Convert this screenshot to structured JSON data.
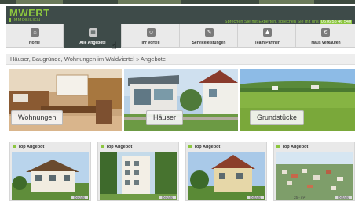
{
  "brand": {
    "name": "MWERT",
    "sub": "IMMOBILIEN",
    "contact_text": "Sprechen Sie mit Experten, sprechen Sie mit uns",
    "phone": "0676 55 46 540"
  },
  "nav": {
    "items": [
      {
        "label": "Home",
        "icon": "home-icon",
        "glyph": "⌂"
      },
      {
        "label": "Alle Angebote",
        "icon": "buildings-icon",
        "glyph": "▦",
        "active": true
      },
      {
        "label": "Ihr Vorteil",
        "icon": "smiley-icon",
        "glyph": "☺"
      },
      {
        "label": "Serviceleistungen",
        "icon": "wrench-icon",
        "glyph": "✎"
      },
      {
        "label": "Team/Partner",
        "icon": "people-icon",
        "glyph": "♟"
      },
      {
        "label": "Haus verkaufen",
        "icon": "euro-icon",
        "glyph": "€"
      }
    ]
  },
  "breadcrumb": "Häuser, Baugründe, Wohnungen im Waldviertel » Angebote",
  "categories": [
    {
      "label": "Wohnungen"
    },
    {
      "label": "Häuser"
    },
    {
      "label": "Grundstücke"
    }
  ],
  "offers": {
    "badge": "Top Angebot",
    "more_label": "Details",
    "items": [
      {
        "price": ""
      },
      {
        "price": ""
      },
      {
        "price": ""
      },
      {
        "price": "25 - m²"
      }
    ]
  },
  "colors": {
    "accent": "#8cc63f",
    "header": "#3e4b49",
    "nav_bg": "#eaeaea"
  }
}
